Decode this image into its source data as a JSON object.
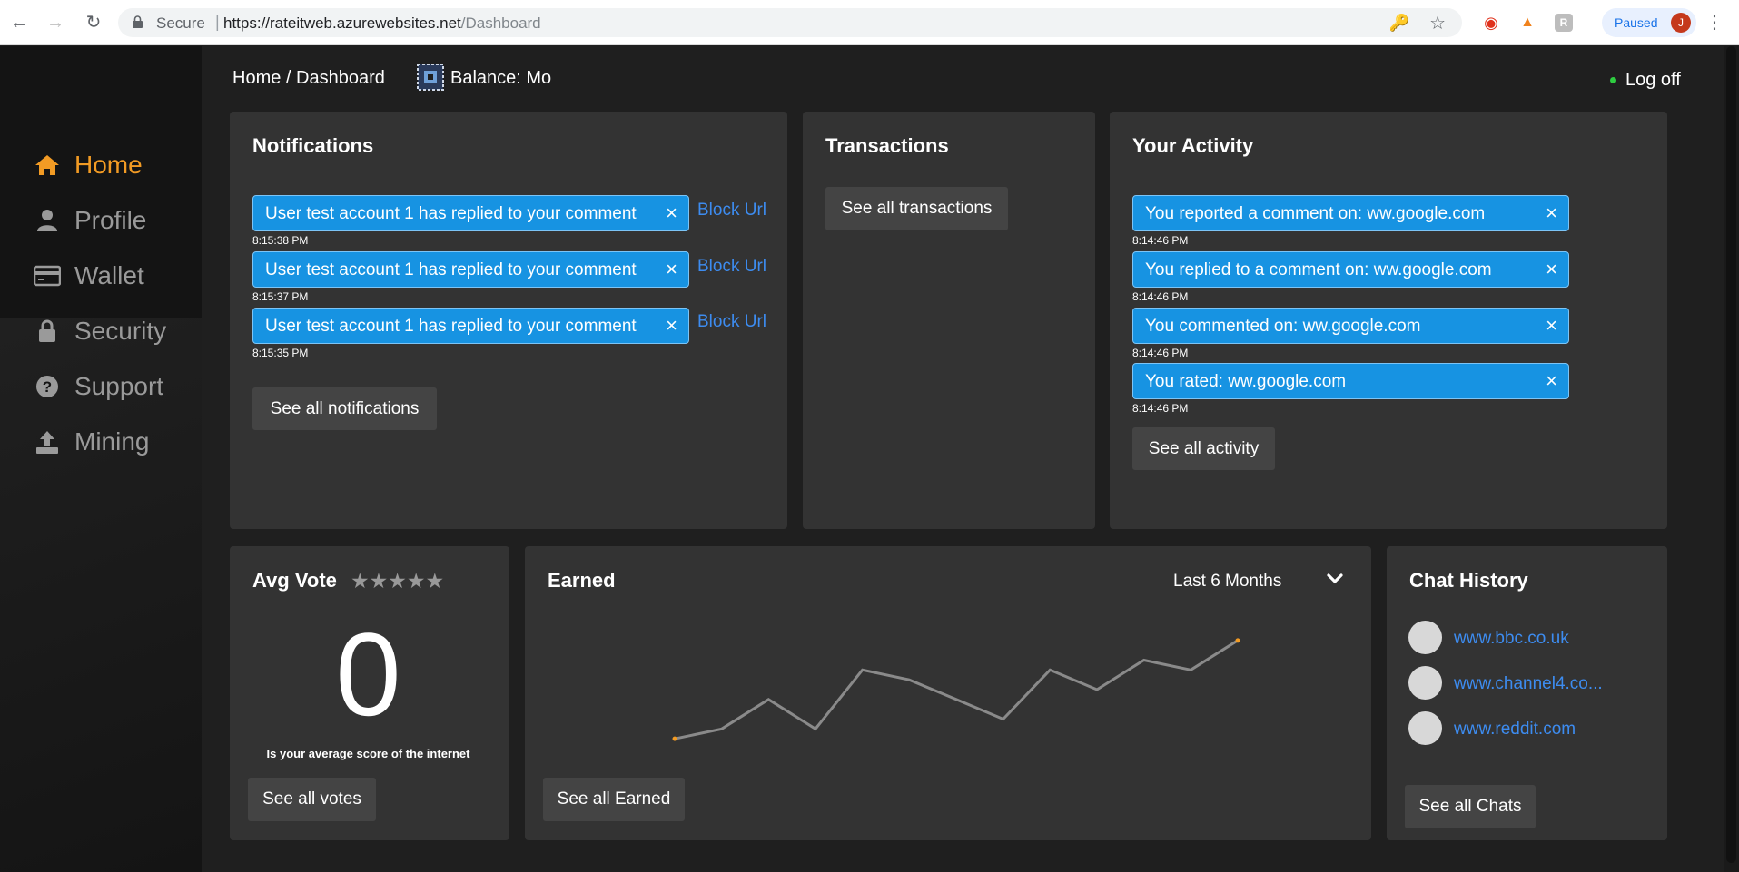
{
  "browser": {
    "secure_label": "Secure",
    "url_host": "https://rateitweb.azurewebsites.net",
    "url_path": "/Dashboard",
    "profile_status": "Paused",
    "profile_initial": "J",
    "extensions": [
      "opera-icon",
      "metamask-icon",
      "r-extension-icon"
    ],
    "ext_r_label": "R"
  },
  "sidebar": {
    "items": [
      {
        "label": "Home",
        "icon": "home-icon",
        "active": true
      },
      {
        "label": "Profile",
        "icon": "user-icon"
      },
      {
        "label": "Wallet",
        "icon": "wallet-icon"
      },
      {
        "label": "Security",
        "icon": "lock-icon"
      },
      {
        "label": "Support",
        "icon": "question-icon"
      },
      {
        "label": "Mining",
        "icon": "upload-icon"
      }
    ]
  },
  "topbar": {
    "breadcrumb": "Home / Dashboard",
    "balance": "Balance: Mo",
    "logoff": "Log off"
  },
  "notifications": {
    "title": "Notifications",
    "items": [
      {
        "text": "User test account 1 has replied to your comment",
        "time": "8:15:38 PM",
        "action": "Block Url"
      },
      {
        "text": "User test account 1 has replied to your comment",
        "time": "8:15:37 PM",
        "action": "Block Url"
      },
      {
        "text": "User test account 1 has replied to your comment",
        "time": "8:15:35 PM",
        "action": "Block Url"
      }
    ],
    "close_glyph": "×",
    "see_all": "See all notifications"
  },
  "transactions": {
    "title": "Transactions",
    "see_all": "See all transactions"
  },
  "activity": {
    "title": "Your Activity",
    "items": [
      {
        "text": "You reported a comment on: ww.google.com",
        "time": "8:14:46 PM"
      },
      {
        "text": "You replied to a comment on: ww.google.com",
        "time": "8:14:46 PM"
      },
      {
        "text": "You commented on: ww.google.com",
        "time": "8:14:46 PM"
      },
      {
        "text": "You rated: ww.google.com",
        "time": "8:14:46 PM"
      }
    ],
    "close_glyph": "×",
    "see_all": "See all activity"
  },
  "avg_vote": {
    "title": "Avg Vote",
    "stars": "★★★★★",
    "rating": 0,
    "value": "0",
    "caption": "Is your average score of the internet",
    "see_all": "See all votes"
  },
  "earned": {
    "title": "Earned",
    "period": "Last 6 Months",
    "see_all": "See all Earned"
  },
  "chat": {
    "title": "Chat History",
    "items": [
      "www.bbc.co.uk",
      "www.channel4.co...",
      "www.reddit.com"
    ],
    "see_all": "See all Chats"
  },
  "colors": {
    "accent": "#f29b24",
    "pill": "#1793e2",
    "link": "#3d8cf0",
    "panel": "#333333",
    "line": "#8a8a8a"
  },
  "chart_data": {
    "type": "line",
    "series": [
      {
        "values": [
          1,
          2,
          5,
          2,
          8,
          7,
          5,
          3,
          8,
          6,
          9,
          8,
          11
        ]
      }
    ],
    "ylim": [
      0,
      12
    ]
  }
}
